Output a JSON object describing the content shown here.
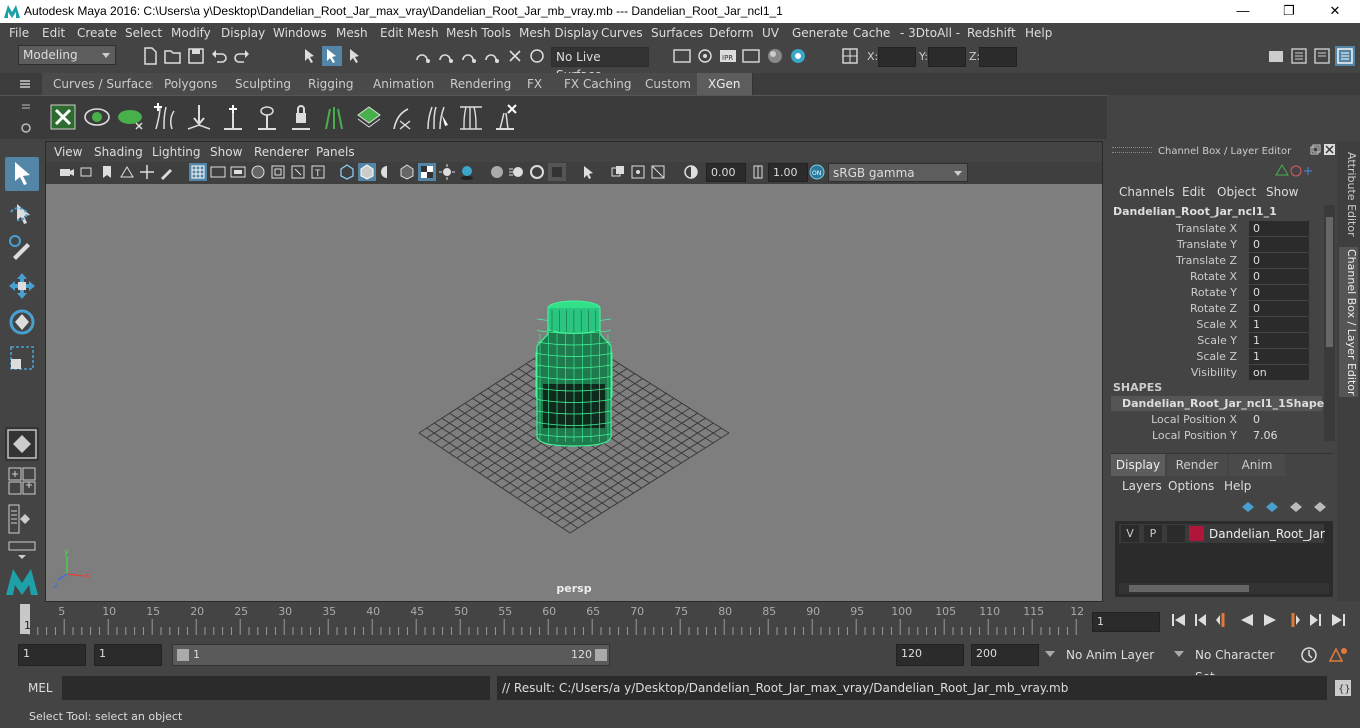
{
  "window": {
    "title": "Autodesk Maya 2016: C:\\Users\\a y\\Desktop\\Dandelian_Root_Jar_max_vray\\Dandelian_Root_Jar_mb_vray.mb   ---   Dandelian_Root_Jar_ncl1_1",
    "minimize": "—",
    "maximize": "❐",
    "close": "✕"
  },
  "menubar": [
    "File",
    "Edit",
    "Create",
    "Select",
    "Modify",
    "Display",
    "Windows",
    "Mesh",
    "Edit Mesh",
    "Mesh Tools",
    "Mesh Display",
    "Curves",
    "Surfaces",
    "Deform",
    "UV",
    "Generate",
    "Cache",
    "- 3DtoAll -",
    "Redshift",
    "Help"
  ],
  "status": {
    "mode": "Modeling",
    "live_surface": "No Live Surface",
    "x_label": "X:",
    "y_label": "Y:",
    "z_label": "Z:",
    "x_value": "",
    "y_value": "",
    "z_value": ""
  },
  "shelf_tabs": [
    {
      "label": "Curves / Surfaces",
      "active": false
    },
    {
      "label": "Polygons",
      "active": false
    },
    {
      "label": "Sculpting",
      "active": false
    },
    {
      "label": "Rigging",
      "active": false
    },
    {
      "label": "Animation",
      "active": false
    },
    {
      "label": "Rendering",
      "active": false
    },
    {
      "label": "FX",
      "active": false
    },
    {
      "label": "FX Caching",
      "active": false
    },
    {
      "label": "Custom",
      "active": false
    },
    {
      "label": "XGen",
      "active": true
    }
  ],
  "viewport": {
    "menus": [
      "View",
      "Shading",
      "Lighting",
      "Show",
      "Renderer",
      "Panels"
    ],
    "exposure": "0.00",
    "gamma": "1.00",
    "color_space": "sRGB gamma",
    "camera": "persp"
  },
  "channel_box": {
    "panel_title": "Channel Box / Layer Editor",
    "menus": [
      "Channels",
      "Edit",
      "Object",
      "Show"
    ],
    "object": "Dandelian_Root_Jar_ncl1_1",
    "attributes": [
      {
        "name": "Translate X",
        "value": "0"
      },
      {
        "name": "Translate Y",
        "value": "0"
      },
      {
        "name": "Translate Z",
        "value": "0"
      },
      {
        "name": "Rotate X",
        "value": "0"
      },
      {
        "name": "Rotate Y",
        "value": "0"
      },
      {
        "name": "Rotate Z",
        "value": "0"
      },
      {
        "name": "Scale X",
        "value": "1"
      },
      {
        "name": "Scale Y",
        "value": "1"
      },
      {
        "name": "Scale Z",
        "value": "1"
      },
      {
        "name": "Visibility",
        "value": "on"
      }
    ],
    "shapes_header": "SHAPES",
    "shape_name": "Dandelian_Root_Jar_ncl1_1Shape",
    "shape_attributes": [
      {
        "name": "Local Position X",
        "value": "0"
      },
      {
        "name": "Local Position Y",
        "value": "7.06"
      }
    ]
  },
  "layer_editor": {
    "tabs": [
      "Display",
      "Render",
      "Anim"
    ],
    "active_tab": "Display",
    "menus": [
      "Layers",
      "Options",
      "Help"
    ],
    "layer": {
      "v": "V",
      "p": "P",
      "name": "Dandelian_Root_Jar",
      "color": "#b0163a"
    }
  },
  "side_tabs": [
    "Attribute Editor",
    "Channel Box / Layer Editor"
  ],
  "timeline": {
    "labels": [
      "5",
      "10",
      "15",
      "20",
      "25",
      "30",
      "35",
      "40",
      "45",
      "50",
      "55",
      "60",
      "65",
      "70",
      "75",
      "80",
      "85",
      "90",
      "95",
      "100",
      "105",
      "110",
      "115",
      "12"
    ],
    "start_label": "1",
    "current_frame": "1"
  },
  "range": {
    "start": "1",
    "playback_start": "1",
    "slider_start": "1",
    "slider_end": "120",
    "playback_end": "120",
    "end": "200",
    "anim_layer": "No Anim Layer",
    "character_set": "No Character Set"
  },
  "mel": {
    "label": "MEL",
    "result": "// Result: C:/Users/a y/Desktop/Dandelian_Root_Jar_max_vray/Dandelian_Root_Jar_mb_vray.mb"
  },
  "help_line": "Select Tool: select an object",
  "colors": {
    "accent": "#5285a6",
    "wire": "#41f59a",
    "viewport_bg": "#7e7e7e"
  }
}
